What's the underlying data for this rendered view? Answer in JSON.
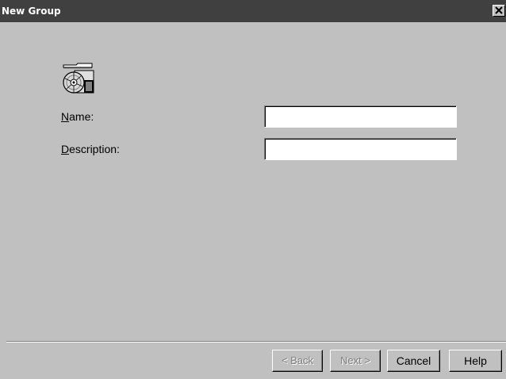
{
  "window": {
    "title": "New Group",
    "close_glyph": "×",
    "icons": {
      "close": "close-icon",
      "group": "group-folder-disc-icon"
    }
  },
  "form": {
    "name": {
      "mnemonic": "N",
      "rest": "ame:",
      "value": ""
    },
    "description": {
      "mnemonic": "D",
      "rest": "escription:",
      "value": ""
    }
  },
  "buttons": {
    "back": "< Back",
    "next": "Next >",
    "cancel": "Cancel",
    "help": "Help"
  },
  "colors": {
    "face": "#c0c0c0",
    "titlebar": "#404040",
    "disabled_text": "#808080"
  }
}
